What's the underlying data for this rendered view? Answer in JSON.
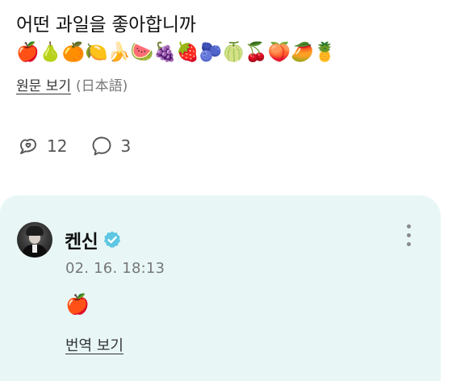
{
  "post": {
    "text": "어떤 과일을 좋아합니까",
    "emojis": "🍎🍐🍊🍋🍌🍉🍇🍓🫐🍈🍒🍑🥭🍍",
    "see_original_label": "원문 보기",
    "original_lang_note": "(日本語)"
  },
  "actions": {
    "likes_count": "12",
    "comments_count": "3",
    "like_icon": "bubble-heart-icon",
    "comment_icon": "speech-bubble-icon"
  },
  "reply": {
    "author": "켄신",
    "verified": true,
    "timestamp": "02. 16. 18:13",
    "content": "🍎",
    "see_translation_label": "번역 보기"
  },
  "colors": {
    "reply_background": "#e8f7f6",
    "verified_badge": "#5ec7e3",
    "text_primary": "#111111",
    "text_secondary": "#777777"
  }
}
